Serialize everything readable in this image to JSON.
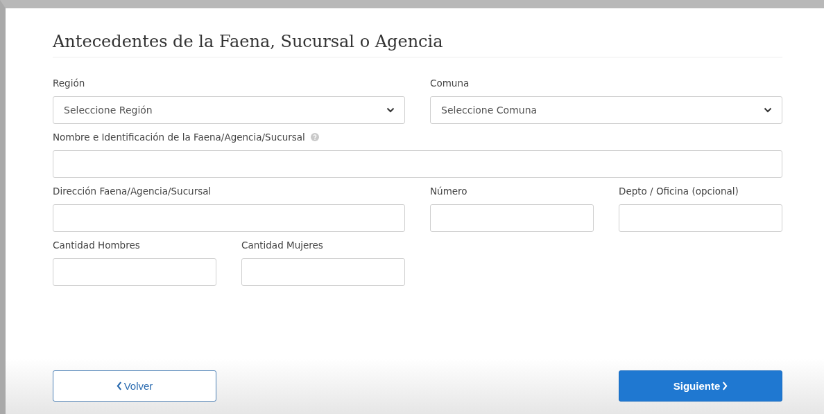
{
  "heading": "Antecedentes de la Faena, Sucursal o Agencia",
  "rows": [
    {
      "fields": [
        {
          "kind": "select",
          "label": "Región",
          "placeholder": "Seleccione Región"
        },
        {
          "kind": "select",
          "label": "Comuna",
          "placeholder": "Seleccione Comuna"
        }
      ]
    },
    {
      "fields": [
        {
          "kind": "text",
          "label": "Nombre e Identificación de la Faena/Agencia/Sucursal",
          "help": true
        }
      ]
    },
    {
      "fields": [
        {
          "kind": "text",
          "label": "Dirección Faena/Agencia/Sucursal"
        },
        {
          "kind": "text",
          "label": "Número"
        },
        {
          "kind": "text",
          "label": "Depto / Oficina (opcional)"
        }
      ]
    },
    {
      "fields": [
        {
          "kind": "text",
          "label": "Cantidad Hombres"
        },
        {
          "kind": "text",
          "label": "Cantidad Mujeres"
        }
      ]
    }
  ],
  "buttons": [
    {
      "kind": "back",
      "label": "Volver"
    },
    {
      "kind": "next",
      "label": "Siguiente"
    }
  ]
}
